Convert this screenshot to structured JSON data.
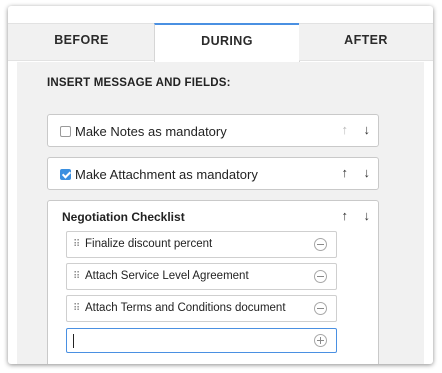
{
  "tabs": [
    {
      "label": "BEFORE",
      "active": false
    },
    {
      "label": "DURING",
      "active": true
    },
    {
      "label": "AFTER",
      "active": false
    }
  ],
  "section_heading": "INSERT MESSAGE AND FIELDS:",
  "rows": [
    {
      "label": "Make Notes as mandatory",
      "checked": false
    },
    {
      "label": "Make Attachment as mandatory",
      "checked": true
    }
  ],
  "arrows": {
    "up": "↑",
    "down": "↓"
  },
  "checklist": {
    "title": "Negotiation Checklist",
    "items": [
      {
        "label": "Finalize discount percent"
      },
      {
        "label": "Attach Service Level Agreement"
      },
      {
        "label": "Attach Terms and Conditions document"
      }
    ],
    "new_item_value": ""
  },
  "icons": {
    "drag": "drag-handle-icon",
    "remove": "minus-circle-icon",
    "add": "plus-circle-icon",
    "up": "arrow-up-icon",
    "down": "arrow-down-icon"
  },
  "colors": {
    "accent": "#4a90e2",
    "checkbox_checked": "#3a8fe0",
    "panel_bg": "#f1f1f1"
  }
}
